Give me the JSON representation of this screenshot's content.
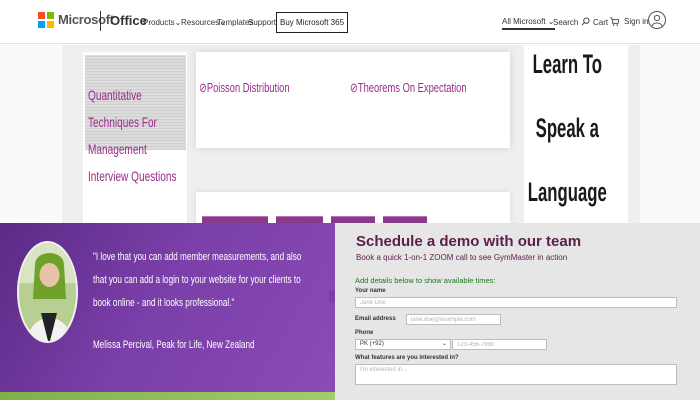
{
  "nav": {
    "brand": "Microsoft",
    "product": "Office",
    "items": [
      {
        "label": "Products"
      },
      {
        "label": "Resources"
      },
      {
        "label": "Templates"
      },
      {
        "label": "Support"
      }
    ],
    "buy_label": "Buy Microsoft 365",
    "all_microsoft": "All Microsoft",
    "search_label": "Search",
    "cart_label": "Cart",
    "signin_label": "Sign in"
  },
  "article": {
    "left_card_title": "Quantitative Techniques For Management Interview Questions",
    "mid_links": [
      "Poisson Distribution",
      "Theorems On Expectation"
    ],
    "right_card_title": "Learn To Speak a Language"
  },
  "testimonial": {
    "quote": "\"I love that you can add member measurements, and also that you can add a login to your website for your clients to book online - and it looks professional.\"",
    "author": "Melissa Percival, Peak for Life, New Zealand"
  },
  "demo_form": {
    "title": "Schedule a demo with our team",
    "subtitle": "Book a quick 1-on-1 ZOOM call to see GymMaster in action",
    "instruction": "Add details below to show available times:",
    "name_label": "Your name",
    "name_placeholder": "Jane Doe",
    "email_label": "Email address",
    "email_placeholder": "jane.doe@example.com",
    "phone_label": "Phone",
    "country_code": "PK (+92)",
    "phone_placeholder": "123-456-7890",
    "features_label": "What features are you interested in?",
    "features_placeholder": "I'm interested in..."
  },
  "colors": {
    "accent_purple": "#9a2c8a",
    "title_maroon": "#5a1f4a",
    "green_text": "#1a7a1a"
  }
}
